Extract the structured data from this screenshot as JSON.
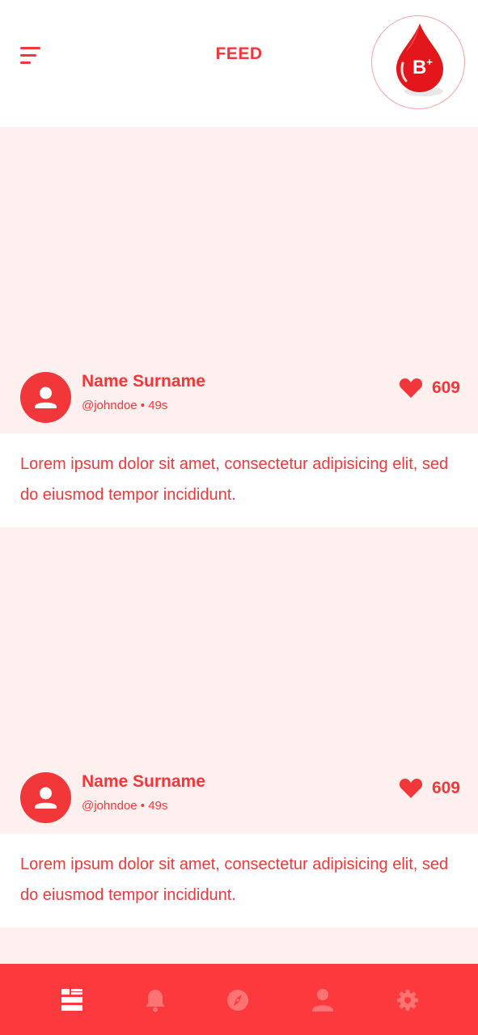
{
  "header": {
    "title": "FEED",
    "blood_type": "B",
    "blood_type_sign": "+"
  },
  "posts": [
    {
      "name": "Name Surname",
      "handle": "@johndoe",
      "age": "49s",
      "meta": "@johndoe • 49s",
      "likes": "609",
      "text": "Lorem ipsum dolor sit amet, consectetur adipisicing elit, sed do eiusmod tempor incididunt."
    },
    {
      "name": "Name Surname",
      "handle": "@johndoe",
      "age": "49s",
      "meta": "@johndoe • 49s",
      "likes": "609",
      "text": "Lorem ipsum dolor sit amet, consectetur adipisicing elit, sed do eiusmod tempor incididunt."
    }
  ],
  "bottom_nav": {
    "items": [
      {
        "icon": "feed-icon",
        "active": true
      },
      {
        "icon": "bell-icon",
        "active": false
      },
      {
        "icon": "compass-icon",
        "active": false
      },
      {
        "icon": "person-icon",
        "active": false
      },
      {
        "icon": "gear-icon",
        "active": false
      }
    ]
  },
  "colors": {
    "accent": "#f2373a",
    "nav_background": "#fc393c",
    "media_placeholder": "#fff0f0",
    "nav_inactive_icon": "#ff7375",
    "nav_active_icon": "#ffffff"
  }
}
